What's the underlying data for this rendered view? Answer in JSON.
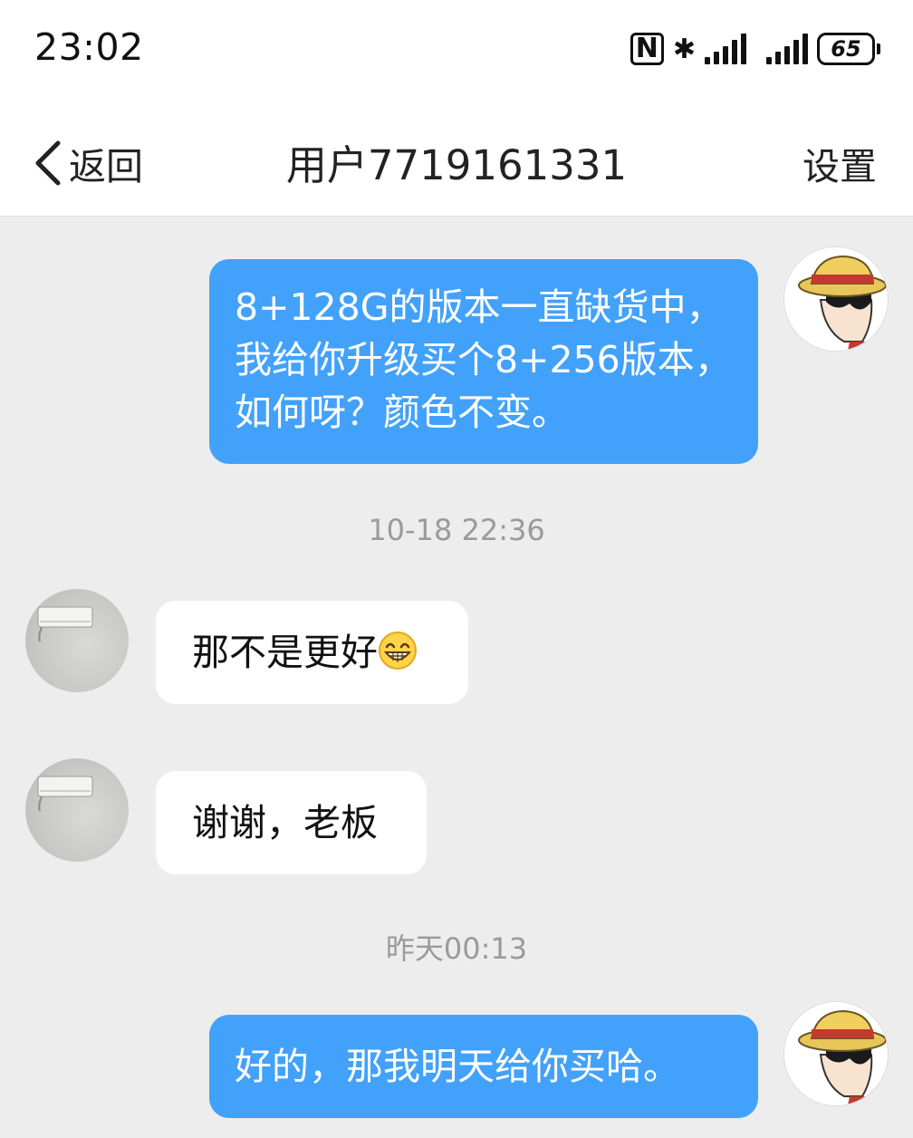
{
  "status_bar": {
    "time": "23:02",
    "battery": "65",
    "nfc_glyph": "N",
    "bluetooth_glyph": "✱"
  },
  "nav": {
    "back_label": "返回",
    "title": "用户7719161331",
    "settings_label": "设置"
  },
  "messages": [
    {
      "side": "mine",
      "text": "8+128G的版本一直缺货中，我给你升级买个8+256版本，如何呀？颜色不变。"
    },
    {
      "type": "timestamp",
      "text": "10-18 22:36"
    },
    {
      "side": "other",
      "text": "那不是更好",
      "emoji": "grinning-face-emoji"
    },
    {
      "side": "other",
      "text": "谢谢，老板"
    },
    {
      "type": "timestamp",
      "text": "昨天00:13"
    },
    {
      "side": "mine",
      "text": "好的，那我明天给你买哈。"
    }
  ],
  "colors": {
    "mine_bubble": "#42a1fb",
    "other_bubble": "#ffffff",
    "chat_background": "#ededed",
    "timestamp_text": "#9a9a9a"
  },
  "icons": {
    "back": "chevron-left-icon",
    "my_avatar": "straw-hat-avatar",
    "other_avatar": "air-conditioner-photo-avatar"
  }
}
